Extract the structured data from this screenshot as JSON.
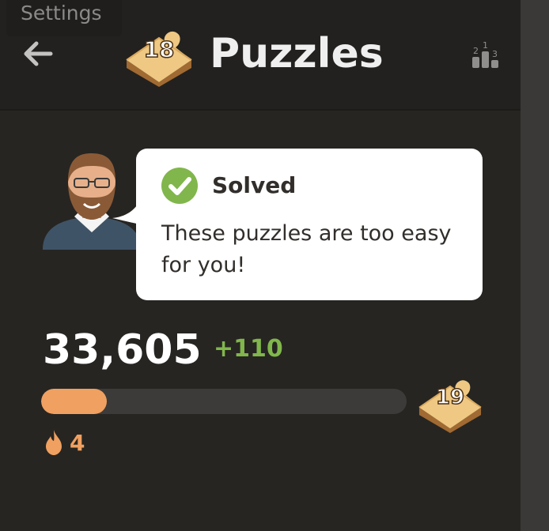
{
  "settings_tab": {
    "label": "Settings"
  },
  "header": {
    "title": "Puzzles",
    "current_level": "18",
    "back_icon": "back-arrow-icon",
    "leaderboard_icon": "leaderboard-icon"
  },
  "coach": {
    "status": "Solved",
    "message": "These puzzles are too easy for you!"
  },
  "rating": {
    "value": "33,605",
    "change": "+110",
    "progress_fraction": 0.18,
    "next_level": "19"
  },
  "streak": {
    "count": "4",
    "icon": "flame-icon"
  },
  "colors": {
    "background": "#262522",
    "accent_green": "#81b64c",
    "progress_orange": "#f0a060"
  }
}
